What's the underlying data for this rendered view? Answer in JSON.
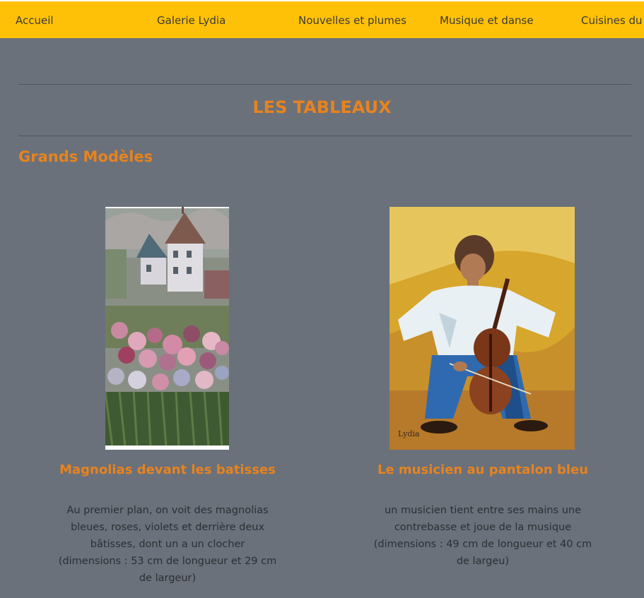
{
  "nav": {
    "items": [
      {
        "label": "Accueil"
      },
      {
        "label": "Galerie Lydia"
      },
      {
        "label": "Nouvelles et plumes"
      },
      {
        "label": "Musique et danse"
      },
      {
        "label": "Cuisines du monde"
      }
    ]
  },
  "page": {
    "title": "LES TABLEAUX",
    "section_title": "Grands Modèles"
  },
  "paintings": [
    {
      "title": "Magnolias devant les batisses",
      "description": "Au premier plan, on voit des magnolias bleues, roses, violets et derrière deux bâtisses, dont un a un clocher (dimensions : 53 cm de longueur et 29 cm de largeur)"
    },
    {
      "title": "Le musicien au pantalon bleu",
      "description": "un musicien tient entre ses mains une contrebasse et joue de la musique (dimensions : 49 cm de longueur et 40 cm de largeu)"
    }
  ],
  "colors": {
    "nav_bg": "#ffc107",
    "page_bg": "#6a717b",
    "accent": "#e8831e",
    "body_text": "#2c2f33"
  }
}
